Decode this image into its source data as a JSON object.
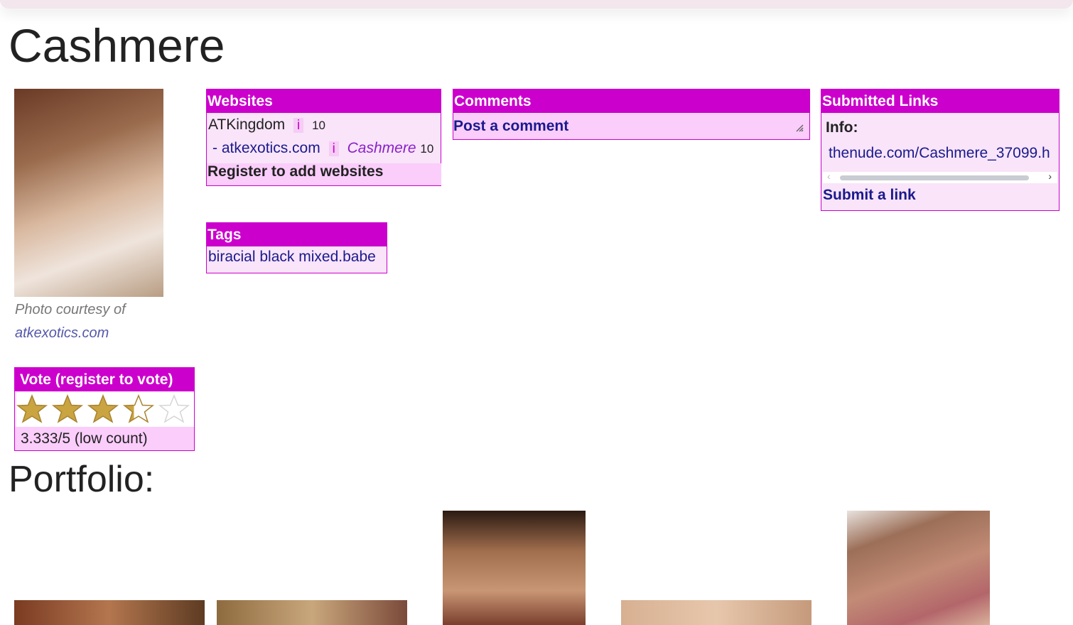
{
  "page": {
    "title": "Cashmere"
  },
  "photo": {
    "caption_prefix": "Photo courtesy of",
    "caption_link": "atkexotics.com"
  },
  "websites": {
    "header": "Websites",
    "rows": [
      {
        "name": "ATKingdom",
        "info": "i",
        "count": "10"
      },
      {
        "name": "- atkexotics.com",
        "info": "i",
        "alias": "Cashmere",
        "count": "10"
      }
    ],
    "register_label": "Register to add websites"
  },
  "tags": {
    "header": "Tags",
    "items": [
      "biracial",
      "black",
      "mixed.babe"
    ]
  },
  "comments": {
    "header": "Comments",
    "post_label": "Post a comment"
  },
  "submitted": {
    "header": "Submitted Links",
    "info_label": "Info:",
    "link": "thenude.com/Cashmere_37099.h",
    "submit_label": "Submit a link"
  },
  "vote": {
    "header": "Vote (register to vote)",
    "rating": 3.333,
    "max": 5,
    "score_text": "3.333/5 (low count)",
    "star_color": "#c9a441"
  },
  "portfolio": {
    "heading": "Portfolio:",
    "thumbnail_count": 5
  },
  "colors": {
    "accent": "#cc00cc",
    "box_bg": "#f9e4f9",
    "row_highlight": "#fbcdfb",
    "link": "#1a1a8c"
  }
}
